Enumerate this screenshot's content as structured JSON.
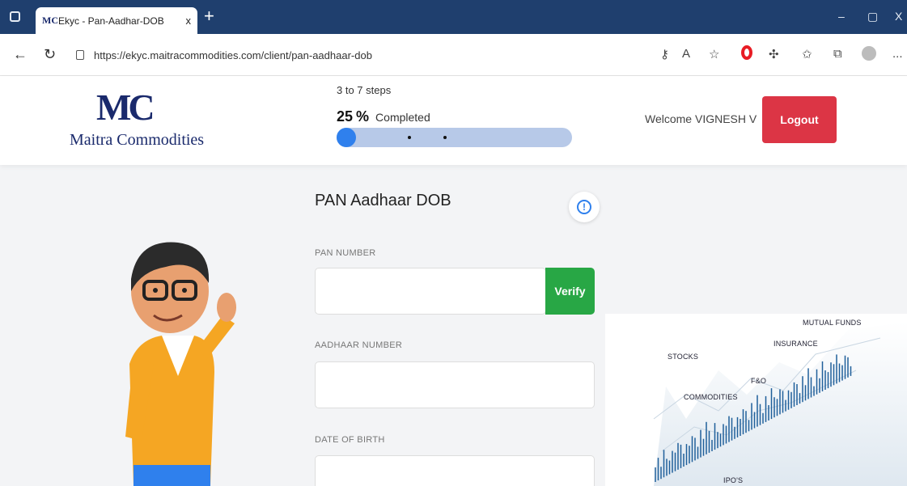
{
  "browser": {
    "tab_title": "Ekyc - Pan-Aadhar-DOB",
    "tab_favicon": "MC",
    "tab_close": "x",
    "new_tab": "+",
    "url": "https://ekyc.maitracommodities.com/client/pan-aadhaar-dob",
    "window_controls": {
      "minimize": "–",
      "restore": "▢",
      "close": "X"
    },
    "more_menu": "..."
  },
  "header": {
    "logo_mark": "MC",
    "logo_text": "Maitra Commodities",
    "steps_label": "3 to 7 steps",
    "percent_value": "25",
    "percent_sign": "%",
    "percent_word": "Completed",
    "progress_fraction": 0.08,
    "welcome": "Welcome VIGNESH V",
    "logout_label": "Logout"
  },
  "form": {
    "title": "PAN Aadhaar DOB",
    "info_glyph": "!",
    "pan_label": "PAN NUMBER",
    "pan_value": "",
    "verify_label": "Verify",
    "aadhaar_label": "AADHAAR NUMBER",
    "aadhaar_value": "",
    "dob_label": "DATE OF BIRTH",
    "dob_value": ""
  },
  "finance_panel": {
    "labels": {
      "mutual_funds": "MUTUAL FUNDS",
      "insurance": "INSURANCE",
      "stocks": "STOCKS",
      "fo": "F&O",
      "commodities": "COMMODITIES",
      "ipos": "IPO'S"
    }
  },
  "colors": {
    "chrome": "#1f3f6e",
    "brand": "#1a2a6c",
    "logout": "#dc3545",
    "verify": "#28a745",
    "progress_track": "#b7c9e8",
    "progress_fill": "#2f80ed"
  }
}
